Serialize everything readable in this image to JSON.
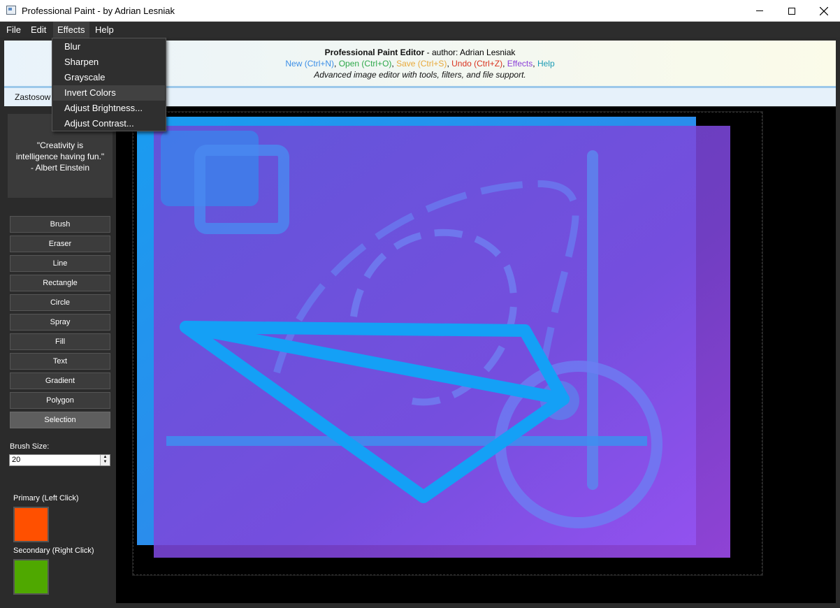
{
  "window": {
    "title": "Professional Paint - by Adrian Lesniak"
  },
  "menubar": {
    "file": "File",
    "edit": "Edit",
    "effects": "Effects",
    "help": "Help"
  },
  "effects_menu": [
    "Blur",
    "Sharpen",
    "Grayscale",
    "Invert Colors",
    "Adjust Brightness...",
    "Adjust Contrast..."
  ],
  "header": {
    "title": "Professional Paint Editor",
    "author": " - author: Adrian Lesniak",
    "new": "New (Ctrl+N)",
    "open": "Open (Ctrl+O)",
    "save": "Save (Ctrl+S)",
    "undo": "Undo (Ctrl+Z)",
    "effects": "Effects",
    "help": "Help",
    "sep": ", ",
    "tagline": "Advanced image editor with tools, filters, and file support.",
    "colors": {
      "new": "#3d8fe6",
      "open": "#2ea84a",
      "save": "#e8a93a",
      "undo": "#d9331f",
      "effects": "#8b3fd8",
      "help": "#1a9bb4"
    }
  },
  "subbar": {
    "label": "Zastosow"
  },
  "quote": {
    "line1": "\"Creativity is",
    "line2": "intelligence having fun.\"",
    "line3": "- Albert Einstein"
  },
  "tools": [
    "Brush",
    "Eraser",
    "Line",
    "Rectangle",
    "Circle",
    "Spray",
    "Fill",
    "Text",
    "Gradient",
    "Polygon",
    "Selection"
  ],
  "selected_tool": "Selection",
  "brush": {
    "label": "Brush Size:",
    "value": "20"
  },
  "colors": {
    "primary_label": "Primary (Left Click)",
    "primary": "#ff5000",
    "secondary_label": "Secondary (Right Click)",
    "secondary": "#4fa800"
  }
}
